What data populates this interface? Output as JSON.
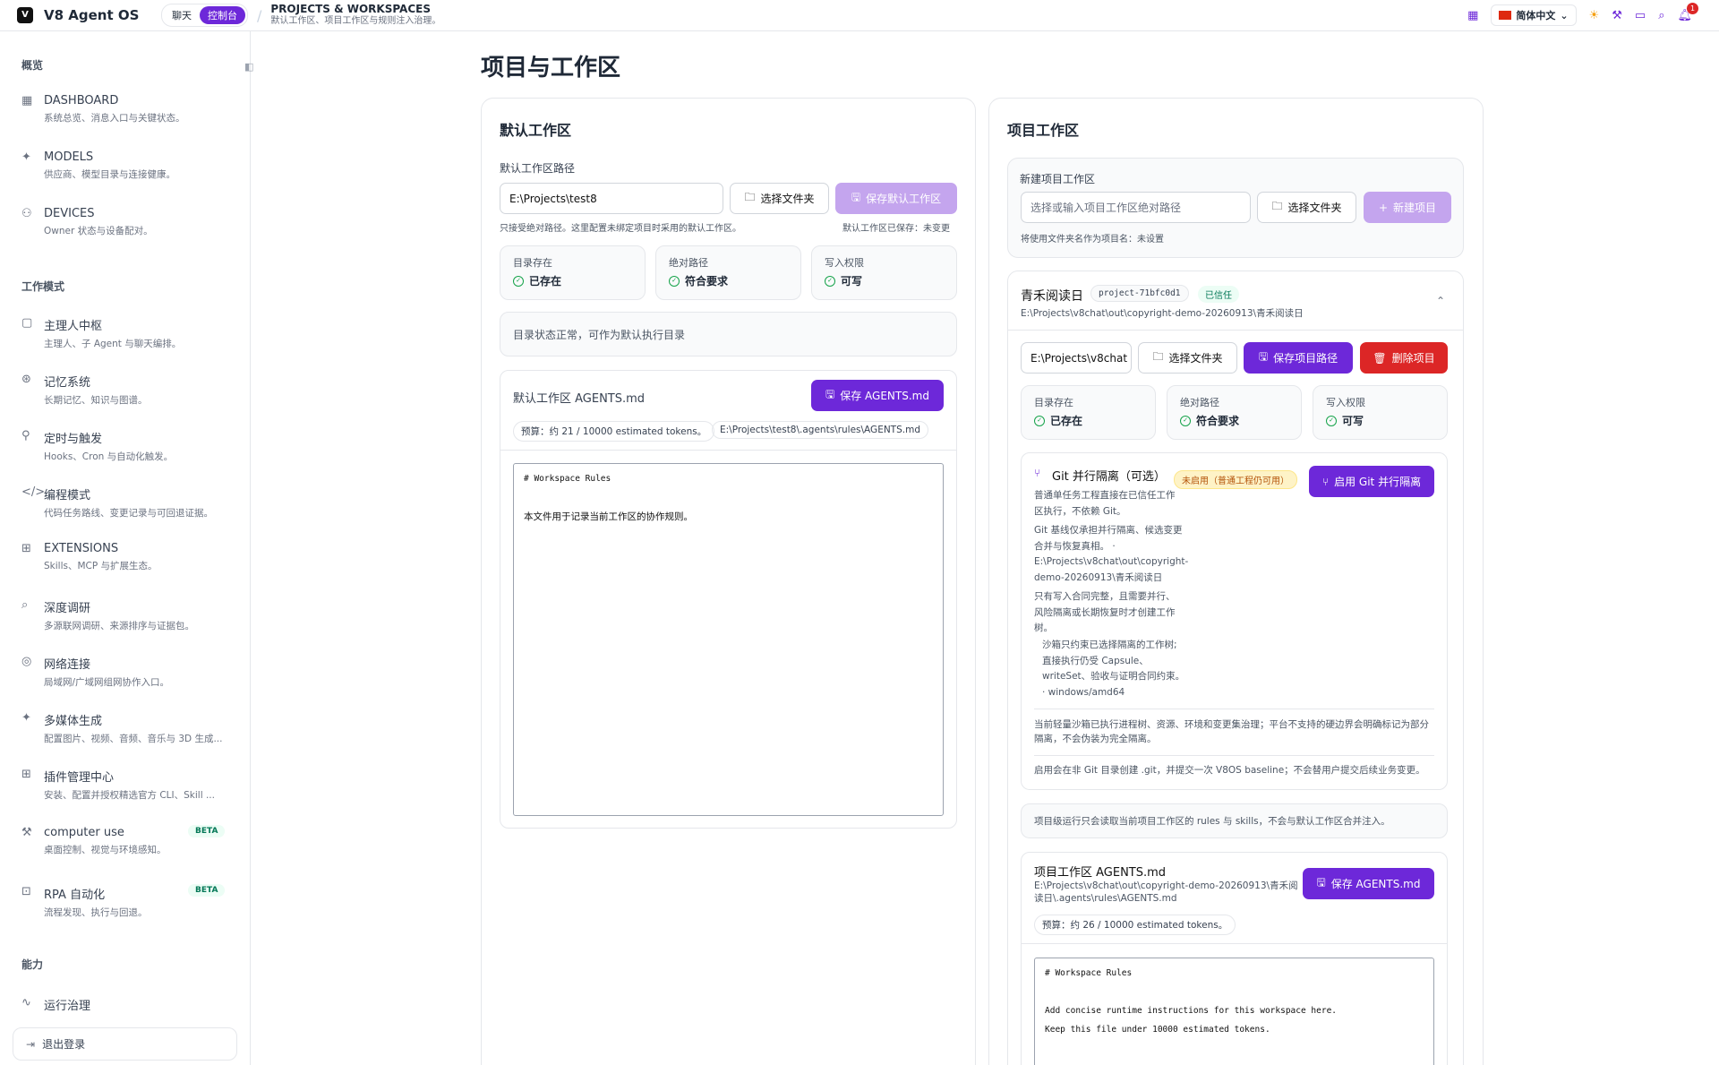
{
  "app": {
    "name": "V8 Agent OS",
    "mode_chat": "聊天",
    "mode_console": "控制台",
    "page_title": "PROJECTS & WORKSPACES",
    "page_subtitle": "默认工作区、项目工作区与规则注入治理。",
    "language": "简体中文",
    "notification_count": "1"
  },
  "sidebar": {
    "sections": [
      "概览",
      "工作模式",
      "能力"
    ],
    "overview": [
      {
        "title": "DASHBOARD",
        "sub": "系统总览、消息入口与关键状态。"
      },
      {
        "title": "MODELS",
        "sub": "供应商、模型目录与连接健康。"
      },
      {
        "title": "DEVICES",
        "sub": "Owner 状态与设备配对。"
      }
    ],
    "work": [
      {
        "title": "主理人中枢",
        "sub": "主理人、子 Agent 与聊天编排。"
      },
      {
        "title": "记忆系统",
        "sub": "长期记忆、知识与图谱。"
      },
      {
        "title": "定时与触发",
        "sub": "Hooks、Cron 与自动化触发。"
      },
      {
        "title": "编程模式",
        "sub": "代码任务路线、变更记录与可回退证据。"
      },
      {
        "title": "EXTENSIONS",
        "sub": "Skills、MCP 与扩展生态。"
      },
      {
        "title": "深度调研",
        "sub": "多源联网调研、来源排序与证据包。"
      },
      {
        "title": "网络连接",
        "sub": "局域网/广域网组网协作入口。"
      },
      {
        "title": "多媒体生成",
        "sub": "配置图片、视频、音频、音乐与 3D 生成..."
      },
      {
        "title": "插件管理中心",
        "sub": "安装、配置并授权精选官方 CLI、Skill ..."
      },
      {
        "title": "computer use",
        "sub": "桌面控制、视觉与环境感知。",
        "badge": "BETA"
      },
      {
        "title": "RPA 自动化",
        "sub": "流程发现、执行与回退。",
        "badge": "BETA"
      }
    ],
    "ability": [
      {
        "title": "运行治理"
      }
    ],
    "logout": "退出登录"
  },
  "main": {
    "title": "项目与工作区"
  },
  "default_ws": {
    "title": "默认工作区",
    "path_label": "默认工作区路径",
    "path_value": "E:\\Projects\\test8",
    "choose_folder": "选择文件夹",
    "save": "保存默认工作区",
    "hint_left": "只接受绝对路径。这里配置未绑定项目时采用的默认工作区。",
    "hint_right": "默认工作区已保存：未变更",
    "stats": [
      {
        "label": "目录存在",
        "value": "已存在"
      },
      {
        "label": "绝对路径",
        "value": "符合要求"
      },
      {
        "label": "写入权限",
        "value": "可写"
      }
    ],
    "status_note": "目录状态正常，可作为默认执行目录",
    "agents_title": "默认工作区 AGENTS.md",
    "agents_save": "保存 AGENTS.md",
    "budget": "预算：约 21 / 10000 estimated tokens。",
    "agents_path": "E:\\Projects\\test8\\.agents\\rules\\AGENTS.md",
    "editor_l1": "# Workspace Rules",
    "editor_l2": "本文件用于记录当前工作区的协作规则。"
  },
  "project_ws": {
    "title": "项目工作区",
    "new_label": "新建项目工作区",
    "new_placeholder": "选择或输入项目工作区绝对路径",
    "choose_folder": "选择文件夹",
    "new_btn": "新建项目",
    "new_hint": "将使用文件夹名作为项目名：未设置",
    "project": {
      "name": "青禾阅读日",
      "id": "project-71bfc0d1",
      "trust": "已信任",
      "path": "E:\\Projects\\v8chat\\out\\copyright-demo-20260913\\青禾阅读日",
      "path_input": "E:\\Projects\\v8chat",
      "choose_folder": "选择文件夹",
      "save_path": "保存项目路径",
      "delete": "删除项目"
    },
    "stats": [
      {
        "label": "目录存在",
        "value": "已存在"
      },
      {
        "label": "绝对路径",
        "value": "符合要求"
      },
      {
        "label": "写入权限",
        "value": "可写"
      }
    ],
    "git": {
      "title": "Git 并行隔离（可选）",
      "badge": "未启用（普通工程仍可用）",
      "enable": "启用 Git 并行隔离",
      "lines": [
        "普通单任务工程直接在已信任工作",
        "区执行，不依赖 Git。",
        "Git 基线仅承担并行隔离、候选变更",
        "合并与恢复真相。 ·",
        "E:\\Projects\\v8chat\\out\\copyright-",
        "demo-20260913\\青禾阅读日",
        "只有写入合同完整，且需要并行、",
        "风险隔离或长期恢复时才创建工作",
        "树。"
      ],
      "sandbox": [
        "沙箱只约束已选择隔离的工作树;",
        "直接执行仍受 Capsule、",
        "writeSet、验收与证明合同约束。",
        "· windows/amd64"
      ],
      "note1a": "当前轻量沙箱已执行进程树、资源、环境和变更集治理；平台不支持的硬边界会明确标记为部分",
      "note1b": "隔离，不会伪装为完全隔离。",
      "note2": "启用会在非 Git 目录创建 .git，并提交一次 V8OS baseline；不会替用户提交后续业务变更。"
    },
    "rules_note": "项目级运行只会读取当前项目工作区的 rules 与 skills，不会与默认工作区合并注入。",
    "agents_title": "项目工作区 AGENTS.md",
    "agents_path1": "E:\\Projects\\v8chat\\out\\copyright-demo-20260913\\青禾阅",
    "agents_path2": "读日\\.agents\\rules\\AGENTS.md",
    "agents_save": "保存 AGENTS.md",
    "budget": "预算：约 26 / 10000 estimated tokens。",
    "editor_l1": "# Workspace Rules",
    "editor_l2": "Add concise runtime instructions for this workspace here.",
    "editor_l3": "Keep this file under 10000 estimated tokens."
  },
  "colors": {
    "primary": "#6d28d9",
    "primary_disabled": "#c4a5ee",
    "danger": "#dc2626",
    "success": "#16a34a"
  }
}
